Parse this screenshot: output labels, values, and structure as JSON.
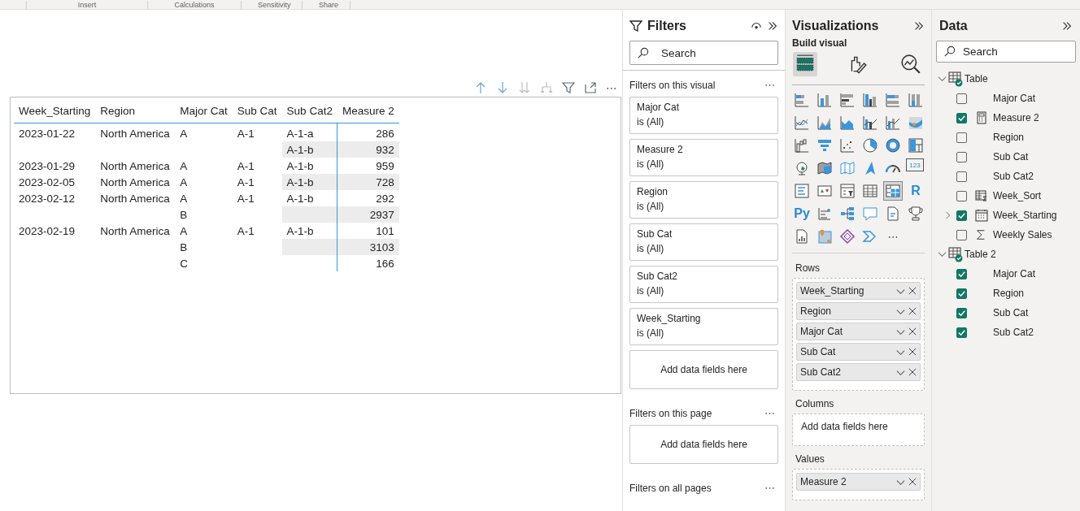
{
  "ribbon": {
    "groups": [
      "Insert",
      "Calculations",
      "Sensitivity",
      "Share"
    ]
  },
  "visual": {
    "toolbar": [
      {
        "kind": "drill-up",
        "disabled": false
      },
      {
        "kind": "drill-down",
        "disabled": false
      },
      {
        "kind": "next-level",
        "disabled": true
      },
      {
        "kind": "expand-hierarchy",
        "disabled": true
      },
      {
        "kind": "filter",
        "disabled": false
      },
      {
        "kind": "focus",
        "disabled": false
      },
      {
        "kind": "more",
        "text": "⋯",
        "disabled": false
      }
    ],
    "table": {
      "columns": [
        {
          "label": "Week_Starting"
        },
        {
          "label": "Region"
        },
        {
          "label": "Major Cat"
        },
        {
          "label": "Sub Cat"
        },
        {
          "label": "Sub Cat2"
        },
        {
          "label": "Measure 2"
        }
      ],
      "rows": [
        {
          "banded": false,
          "cells": [
            "2023-01-22",
            "North America",
            "A",
            "A-1",
            "A-1-a",
            "286"
          ]
        },
        {
          "banded": true,
          "cells": [
            null,
            null,
            null,
            null,
            "A-1-b",
            "932"
          ]
        },
        {
          "banded": false,
          "cells": [
            "2023-01-29",
            "North America",
            "A",
            "A-1",
            "A-1-b",
            "959"
          ]
        },
        {
          "banded": true,
          "cells": [
            "2023-02-05",
            "North America",
            "A",
            "A-1",
            "A-1-b",
            "728"
          ]
        },
        {
          "banded": false,
          "cells": [
            "2023-02-12",
            "North America",
            "A",
            "A-1",
            "A-1-b",
            "292"
          ]
        },
        {
          "banded": true,
          "cells": [
            null,
            null,
            "B",
            null,
            null,
            "2937"
          ]
        },
        {
          "banded": false,
          "cells": [
            "2023-02-19",
            "North America",
            "A",
            "A-1",
            "A-1-b",
            "101"
          ]
        },
        {
          "banded": true,
          "cells": [
            null,
            null,
            "B",
            null,
            null,
            "3103"
          ]
        },
        {
          "banded": false,
          "cells": [
            null,
            null,
            "C",
            null,
            null,
            "166"
          ]
        }
      ]
    }
  },
  "filters": {
    "title": "Filters",
    "search_placeholder": "Search",
    "sections": [
      {
        "title": "Filters on this visual",
        "more": "⋯",
        "cards": [
          {
            "field": "Major Cat",
            "condition": "is (All)"
          },
          {
            "field": "Measure 2",
            "condition": "is (All)"
          },
          {
            "field": "Region",
            "condition": "is (All)"
          },
          {
            "field": "Sub Cat",
            "condition": "is (All)"
          },
          {
            "field": "Sub Cat2",
            "condition": "is (All)"
          },
          {
            "field": "Week_Starting",
            "condition": "is (All)"
          }
        ],
        "drop_hint": "Add data fields here"
      },
      {
        "title": "Filters on this page",
        "more": "⋯",
        "drop_hint": "Add data fields here"
      },
      {
        "title": "Filters on all pages",
        "more": "⋯"
      }
    ]
  },
  "visualizations": {
    "title": "Visualizations",
    "subtitle": "Build visual",
    "modes": [
      {
        "kind": "build",
        "selected": true
      },
      {
        "kind": "format",
        "selected": false
      },
      {
        "kind": "analytics",
        "selected": false
      }
    ],
    "gallery": [
      {
        "selected": false
      },
      {
        "selected": false
      },
      {
        "selected": false
      },
      {
        "selected": false
      },
      {
        "selected": false
      },
      {
        "selected": false
      },
      {
        "selected": false
      },
      {
        "selected": false
      },
      {
        "selected": false
      },
      {
        "selected": false
      },
      {
        "selected": false
      },
      {
        "selected": false
      },
      {
        "selected": false
      },
      {
        "selected": false
      },
      {
        "selected": false
      },
      {
        "selected": false
      },
      {
        "selected": false
      },
      {
        "selected": false
      },
      {
        "selected": false
      },
      {
        "selected": false
      },
      {
        "selected": false
      },
      {
        "selected": false
      },
      {
        "selected": false
      },
      {
        "glyph": "123",
        "selected": false
      },
      {
        "selected": false
      },
      {
        "selected": false
      },
      {
        "selected": false
      },
      {
        "selected": false
      },
      {
        "selected": true
      },
      {
        "glyph": "R",
        "selected": false
      },
      {
        "glyph": "Py",
        "selected": false
      },
      {
        "selected": false
      },
      {
        "selected": false
      },
      {
        "selected": false
      },
      {
        "selected": false
      },
      {
        "selected": false
      },
      {
        "selected": false
      },
      {
        "selected": false
      },
      {
        "selected": false
      },
      {
        "selected": false
      }
    ],
    "more": "⋯",
    "wells": [
      {
        "label": "Rows",
        "fields": [
          "Week_Starting",
          "Region",
          "Major Cat",
          "Sub Cat",
          "Sub Cat2"
        ]
      },
      {
        "label": "Columns",
        "drop_hint": "Add data fields here"
      },
      {
        "label": "Values",
        "fields": [
          "Measure 2"
        ]
      }
    ]
  },
  "data": {
    "title": "Data",
    "search_placeholder": "Search",
    "tables": [
      {
        "name": "Table",
        "expanded": true,
        "in_use": true,
        "fields": [
          {
            "name": "Major Cat",
            "checked": false,
            "kind": "column"
          },
          {
            "name": "Measure 2",
            "checked": true,
            "kind": "measure"
          },
          {
            "name": "Region",
            "checked": false,
            "kind": "column"
          },
          {
            "name": "Sub Cat",
            "checked": false,
            "kind": "column"
          },
          {
            "name": "Sub Cat2",
            "checked": false,
            "kind": "column"
          },
          {
            "name": "Week_Sort",
            "checked": false,
            "kind": "calc"
          },
          {
            "name": "Week_Starting",
            "checked": true,
            "kind": "date"
          },
          {
            "name": "Weekly Sales",
            "checked": false,
            "kind": "sum"
          }
        ]
      },
      {
        "name": "Table 2",
        "expanded": true,
        "in_use": true,
        "fields": [
          {
            "name": "Major Cat",
            "checked": true,
            "kind": "column"
          },
          {
            "name": "Region",
            "checked": true,
            "kind": "column"
          },
          {
            "name": "Sub Cat",
            "checked": true,
            "kind": "column"
          },
          {
            "name": "Sub Cat2",
            "checked": true,
            "kind": "column"
          }
        ]
      }
    ]
  }
}
